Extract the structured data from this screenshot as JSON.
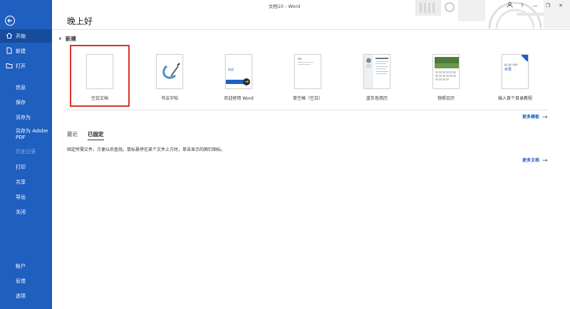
{
  "window": {
    "title": "文档10 - Word",
    "controls": {
      "minimize": "—",
      "restore": "❐",
      "close": "✕",
      "help": "?"
    }
  },
  "sidebar": {
    "items": [
      {
        "label": "开始",
        "icon": "home-icon"
      },
      {
        "label": "新建",
        "icon": "new-document-icon"
      },
      {
        "label": "打开",
        "icon": "folder-icon"
      },
      {
        "label": "信息"
      },
      {
        "label": "保存"
      },
      {
        "label": "另存为"
      },
      {
        "label": "另存为 Adobe PDF"
      },
      {
        "label": "历史记录"
      },
      {
        "label": "打印"
      },
      {
        "label": "共享"
      },
      {
        "label": "导出"
      },
      {
        "label": "关闭"
      }
    ],
    "bottom": [
      {
        "label": "帐户"
      },
      {
        "label": "反馈"
      },
      {
        "label": "选项"
      }
    ]
  },
  "main": {
    "greeting": "晚上好",
    "new_section": "新建",
    "templates": [
      {
        "label": "空白文档"
      },
      {
        "label": "书法字帖"
      },
      {
        "label": "欢迎使用 Word",
        "thumb_text": "欢迎"
      },
      {
        "label": "单空格（空白）",
        "thumb_text": "Aa"
      },
      {
        "label": "蓝灰色简历"
      },
      {
        "label": "快照日历"
      },
      {
        "label": "插入首个目录教程",
        "thumb_text": "目录",
        "thumb_small": "插入首个目录"
      }
    ],
    "more_templates": "更多模板",
    "tabs": [
      {
        "label": "最近"
      },
      {
        "label": "已固定"
      }
    ],
    "pinned_desc": "固定所需文件，方便以后查找。鼠标悬停在某个文件上方时，单击显示的图钉图标。",
    "more_documents": "更多文档"
  },
  "colors": {
    "accent": "#1f5fbf",
    "selection": "#d9342b"
  }
}
